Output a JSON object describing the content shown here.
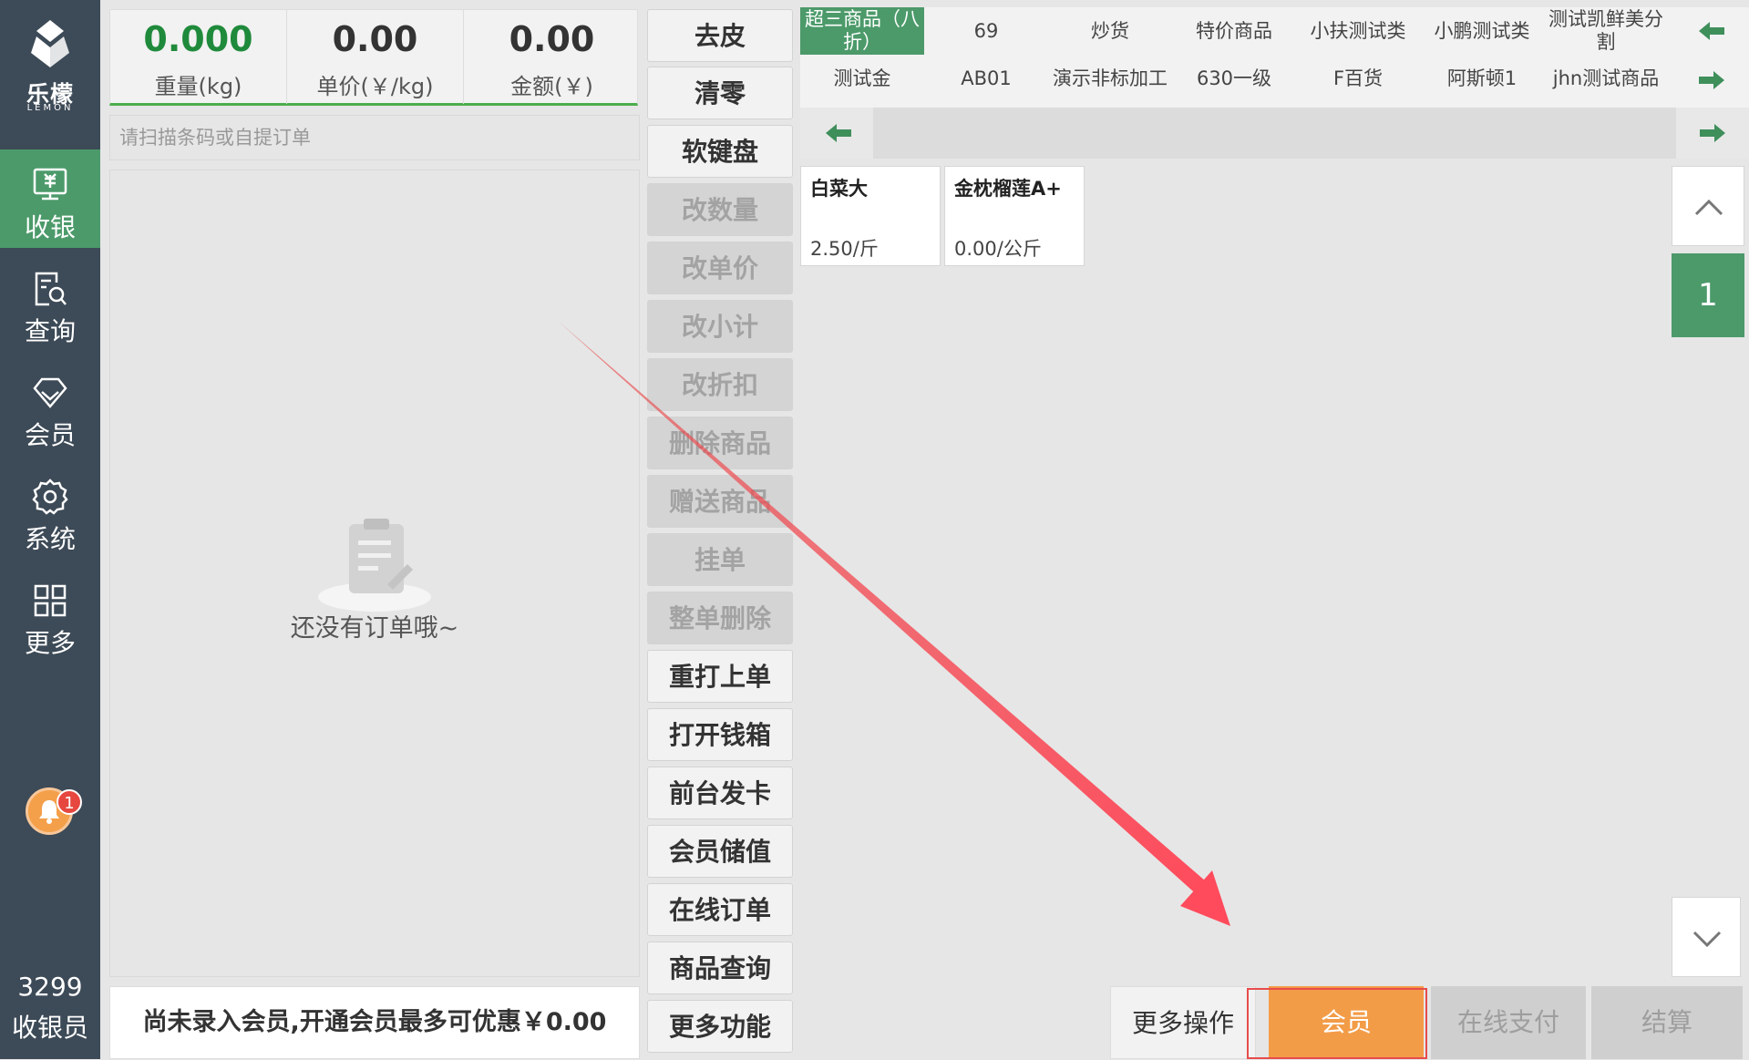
{
  "nav": {
    "logo_cn": "乐檬",
    "logo_en": "LEMON",
    "items": [
      {
        "label": "收银",
        "icon": "cash-register-icon"
      },
      {
        "label": "查询",
        "icon": "search-document-icon"
      },
      {
        "label": "会员",
        "icon": "diamond-icon"
      },
      {
        "label": "系统",
        "icon": "gear-icon"
      },
      {
        "label": "更多",
        "icon": "grid-icon"
      }
    ],
    "notification_count": "1",
    "user_id": "3299",
    "user_role": "收银员"
  },
  "scale": {
    "weight_value": "0.000",
    "weight_label": "重量(kg)",
    "price_value": "0.00",
    "price_label": "单价(￥/kg)",
    "amount_value": "0.00",
    "amount_label": "金额(￥)"
  },
  "scan": {
    "placeholder": "请扫描条码或自提订单"
  },
  "order": {
    "empty_text": "还没有订单哦~"
  },
  "promo": {
    "text": "尚未录入会员,开通会员最多可优惠￥0.00"
  },
  "functions": [
    {
      "label": "去皮",
      "enabled": true
    },
    {
      "label": "清零",
      "enabled": true
    },
    {
      "label": "软键盘",
      "enabled": true
    },
    {
      "label": "改数量",
      "enabled": false
    },
    {
      "label": "改单价",
      "enabled": false
    },
    {
      "label": "改小计",
      "enabled": false
    },
    {
      "label": "改折扣",
      "enabled": false
    },
    {
      "label": "删除商品",
      "enabled": false
    },
    {
      "label": "赠送商品",
      "enabled": false
    },
    {
      "label": "挂单",
      "enabled": false
    },
    {
      "label": "整单删除",
      "enabled": false
    },
    {
      "label": "重打上单",
      "enabled": true
    },
    {
      "label": "打开钱箱",
      "enabled": true
    },
    {
      "label": "前台发卡",
      "enabled": true
    },
    {
      "label": "会员储值",
      "enabled": true
    },
    {
      "label": "在线订单",
      "enabled": true
    },
    {
      "label": "商品查询",
      "enabled": true
    },
    {
      "label": "更多功能",
      "enabled": true
    }
  ],
  "categories": {
    "row1": [
      "超三商品（八折）",
      "69",
      "炒货",
      "特价商品",
      "小扶测试类",
      "小鹏测试类",
      "测试凯鲜美分割"
    ],
    "row2": [
      "测试金",
      "AB01",
      "演示非标加工",
      "630一级",
      "F百货",
      "阿斯顿1",
      "jhn测试商品"
    ]
  },
  "products": [
    {
      "name": "白菜大",
      "price": "2.50/斤"
    },
    {
      "name": "金枕榴莲A+",
      "price": "0.00/公斤"
    }
  ],
  "pager": {
    "page": "1"
  },
  "actions": {
    "more_ops": "更多操作",
    "member": "会员",
    "online_pay": "在线支付",
    "checkout": "结算"
  },
  "colors": {
    "nav_bg": "#3d4a57",
    "accent_green": "#4c9a6a",
    "member_orange": "#f39c48",
    "annotation_red": "#e74c4c"
  }
}
